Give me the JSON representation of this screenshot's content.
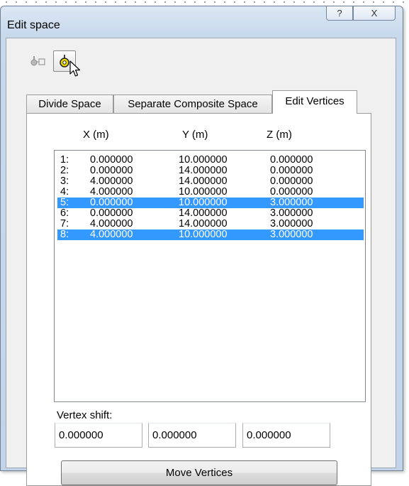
{
  "window": {
    "title": "Edit space",
    "help_glyph": "?",
    "close_glyph": "X"
  },
  "toolbar": {
    "tools": [
      {
        "icon": "pick-vertex-icon"
      },
      {
        "icon": "select-vertex-icon",
        "pressed": true
      }
    ]
  },
  "tabs": [
    {
      "label": "Divide Space",
      "active": false
    },
    {
      "label": "Separate Composite Space",
      "active": false
    },
    {
      "label": "Edit Vertices",
      "active": true
    }
  ],
  "columns": {
    "x": "X (m)",
    "y": "Y (m)",
    "z": "Z (m)"
  },
  "vertices": [
    {
      "idx": "1:",
      "x": "0.000000",
      "y": "10.000000",
      "z": "0.000000",
      "selected": false
    },
    {
      "idx": "2:",
      "x": "0.000000",
      "y": "14.000000",
      "z": "0.000000",
      "selected": false
    },
    {
      "idx": "3:",
      "x": "4.000000",
      "y": "14.000000",
      "z": "0.000000",
      "selected": false
    },
    {
      "idx": "4:",
      "x": "4.000000",
      "y": "10.000000",
      "z": "0.000000",
      "selected": false
    },
    {
      "idx": "5:",
      "x": "0.000000",
      "y": "10.000000",
      "z": "3.000000",
      "selected": true
    },
    {
      "idx": "6:",
      "x": "0.000000",
      "y": "14.000000",
      "z": "3.000000",
      "selected": false
    },
    {
      "idx": "7:",
      "x": "4.000000",
      "y": "14.000000",
      "z": "3.000000",
      "selected": false
    },
    {
      "idx": "8:",
      "x": "4.000000",
      "y": "10.000000",
      "z": "3.000000",
      "selected": true
    }
  ],
  "shift": {
    "label": "Vertex shift:",
    "x": "0.000000",
    "y": "0.000000",
    "z": "0.000000"
  },
  "move_button": "Move Vertices",
  "colors": {
    "selection": "#3399ff",
    "frame": "#c8d9ec"
  }
}
